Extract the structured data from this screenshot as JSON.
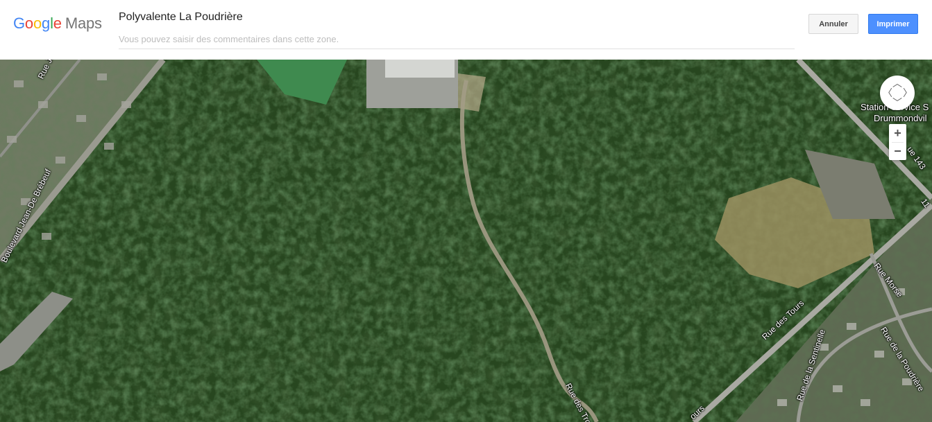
{
  "header": {
    "logo": {
      "letters": [
        "G",
        "o",
        "o",
        "g",
        "l",
        "e"
      ],
      "product": "Maps"
    },
    "place_title": "Polyvalente La Poudrière",
    "comment_placeholder": "Vous pouvez saisir des commentaires dans cette zone.",
    "comment_value": "",
    "cancel_label": "Annuler",
    "print_label": "Imprimer"
  },
  "map": {
    "view": "satellite",
    "road_labels": {
      "brebeuf": "Boulevard Jean-De Brébeuf",
      "rue_je": "Rue Je",
      "station": "Station-service S",
      "drummondville": "Drummondvil",
      "route143": "ue 143",
      "route110": "11",
      "rue_morse": "Rue Morse",
      "rue_des_tours": "Rue des Tours",
      "rue_des_tours_2": "ours",
      "rue_poudriere": "Rue de la Poudrière",
      "rue_sentinelle": "Rue de la Sentinelle",
      "rue_trois": "Rue des Trois M"
    },
    "controls": {
      "pan_icon": "pan-arrows-icon",
      "zoom_in": "+",
      "zoom_out": "−"
    }
  }
}
